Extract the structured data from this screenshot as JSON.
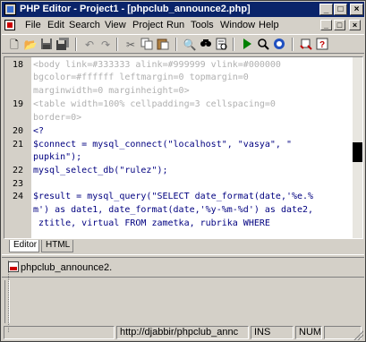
{
  "window": {
    "title": "PHP Editor - Project1 - [phpclub_announce2.php]"
  },
  "caption_buttons": {
    "minimize": "_",
    "maximize": "□",
    "close": "×"
  },
  "mdi_buttons": {
    "minimize": "_",
    "restore": "□",
    "close": "×"
  },
  "menu": [
    "File",
    "Edit",
    "Search",
    "View",
    "Project",
    "Run",
    "Tools",
    "Window",
    "Help"
  ],
  "toolbar_icons": [
    "new-file-icon",
    "open-folder-icon",
    "save-icon",
    "save-all-icon",
    "undo-icon",
    "redo-icon",
    "cut-icon",
    "copy-icon",
    "paste-icon",
    "find-icon",
    "replace-icon",
    "find-next-icon",
    "run-icon",
    "preview-icon",
    "stop-icon",
    "settings-icon",
    "help-icon"
  ],
  "editor": {
    "lines": [
      {
        "num": "18",
        "text": "<body link=#333333 alink=#999999 vlink=#000000"
      },
      {
        "num": "",
        "text": "bgcolor=#ffffff leftmargin=0 topmargin=0"
      },
      {
        "num": "",
        "text": "marginwidth=0 marginheight=0>"
      },
      {
        "num": "19",
        "text": "<table width=100% cellpadding=3 cellspacing=0"
      },
      {
        "num": "",
        "text": "border=0>"
      },
      {
        "num": "20",
        "text": "<?"
      },
      {
        "num": "21",
        "text": "$connect = mysql_connect(\"localhost\", \"vasya\", \""
      },
      {
        "num": "",
        "text": "pupkin\");"
      },
      {
        "num": "22",
        "text": "mysql_select_db(\"rulez\");"
      },
      {
        "num": "23",
        "text": ""
      },
      {
        "num": "24",
        "text": "$result = mysql_query(\"SELECT date_format(date,'%e.%"
      },
      {
        "num": "",
        "text": "m') as date1, date_format(date,'%y-%m-%d') as date2,"
      },
      {
        "num": "",
        "text": " ztitle, virtual FROM zametka, rubrika WHERE"
      }
    ]
  },
  "tabs": [
    "Editor",
    "HTML"
  ],
  "file_tree": {
    "file": "phpclub_announce2."
  },
  "status": {
    "url": "http://djabbir/phpclub_annc",
    "ins": "INS",
    "num": "NUM"
  }
}
